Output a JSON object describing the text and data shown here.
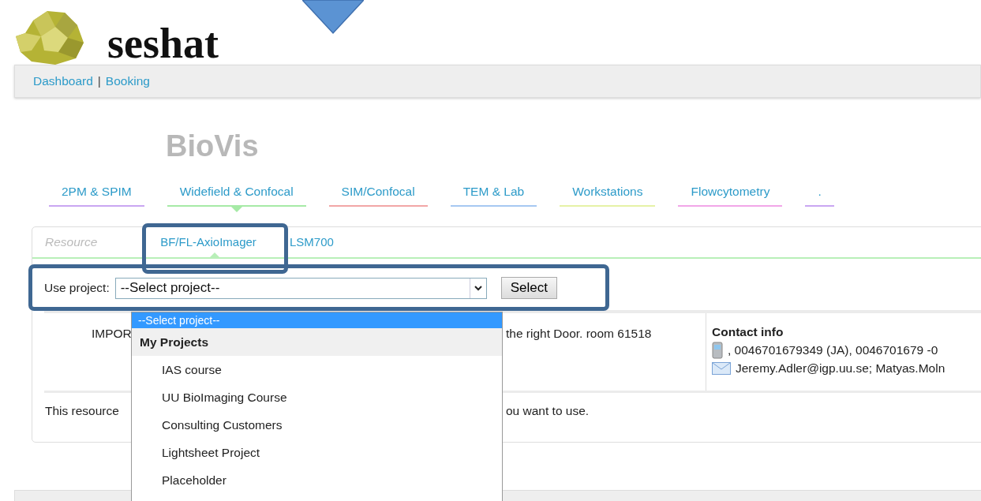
{
  "logo": {
    "text": "seshat"
  },
  "nav": {
    "links": [
      {
        "label": "Dashboard"
      },
      {
        "label": "Booking"
      }
    ],
    "separator": "|"
  },
  "facility": {
    "title": "BioVis"
  },
  "tabs": [
    {
      "label": "2PM & SPIM",
      "selected": false,
      "color": "#c9a6f2"
    },
    {
      "label": "Widefield & Confocal",
      "selected": true,
      "color": "#a6eaa6"
    },
    {
      "label": "SIM/Confocal",
      "selected": false,
      "color": "#f2a6a6"
    },
    {
      "label": "TEM & Lab",
      "selected": false,
      "color": "#a6c8f2"
    },
    {
      "label": "Workstations",
      "selected": false,
      "color": "#e6f2a6"
    },
    {
      "label": "Flowcytometry",
      "selected": false,
      "color": "#f2a6e8"
    },
    {
      "label": ".",
      "selected": false,
      "color": "#c9a6f2"
    }
  ],
  "resource_tabs": {
    "heading": "Resource",
    "tabs": [
      {
        "label": "BF/FL-AxioImager",
        "selected": true
      },
      {
        "label": "LSM700",
        "selected": false
      }
    ]
  },
  "project_form": {
    "label": "Use project:",
    "select_value": "--Select project--",
    "button": "Select"
  },
  "dropdown": {
    "options": [
      {
        "kind": "option",
        "label": "--Select project--",
        "selected": true
      },
      {
        "kind": "group",
        "label": "My Projects"
      },
      {
        "kind": "option",
        "label": "IAS course",
        "selected": false
      },
      {
        "kind": "option",
        "label": "UU BioImaging Course",
        "selected": false
      },
      {
        "kind": "option",
        "label": "Consulting Customers",
        "selected": false
      },
      {
        "kind": "option",
        "label": "Lightsheet Project",
        "selected": false
      },
      {
        "kind": "option",
        "label": "Placeholder",
        "selected": false
      }
    ]
  },
  "info": {
    "notice_left": "IMPOR",
    "notice_right": "the right Door. room 61518",
    "contact_heading": "Contact info",
    "phone": ", 0046701679349 (JA), 0046701679 -0",
    "email": "Jeremy.Adler@igp.uu.se; Matyas.Moln"
  },
  "footer_note": {
    "left": "This resource",
    "right": "ou want to use."
  }
}
